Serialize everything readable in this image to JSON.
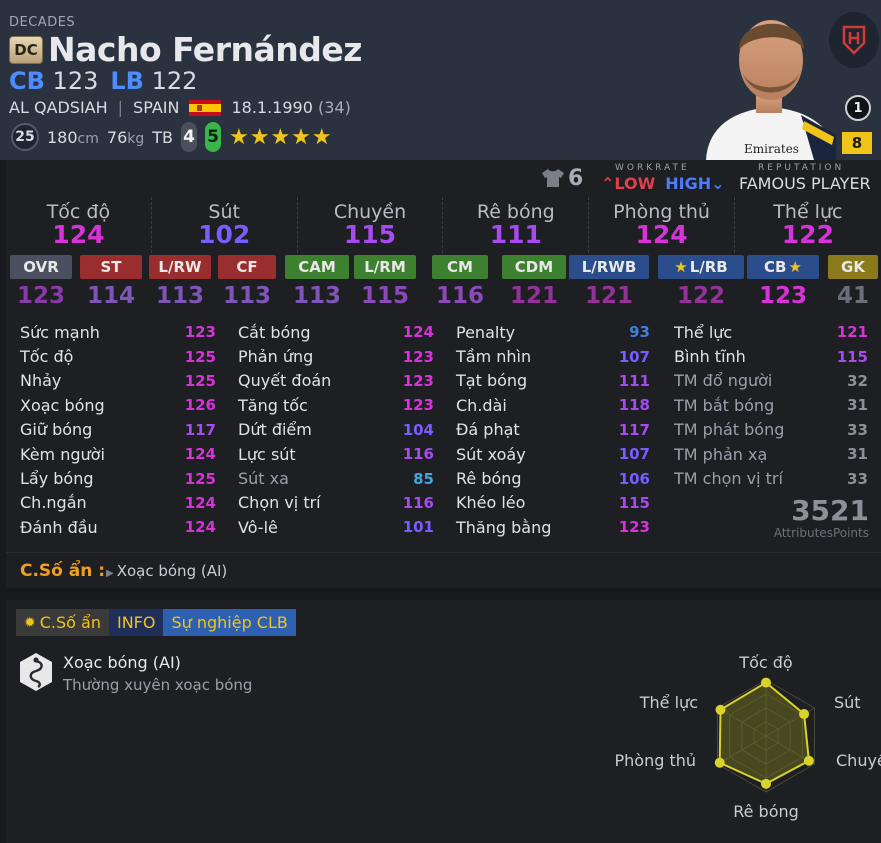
{
  "header": {
    "season": "DECADES",
    "season_badge": "DC",
    "player_name": "Nacho Fernández",
    "positions": [
      {
        "pos": "CB",
        "value": "123"
      },
      {
        "pos": "LB",
        "value": "122"
      }
    ],
    "club": "AL QADSIAH",
    "nation": "SPAIN",
    "dob": "18.1.1990",
    "age": "(34)",
    "circle_value": "25",
    "height": "180",
    "height_unit": "cm",
    "weight": "76",
    "weight_unit": "kg",
    "body_type": "TB",
    "weak_foot": "4",
    "skill_moves": "5",
    "stars": "★★★★★",
    "jersey_badge": "1",
    "grade": "8"
  },
  "workrate": {
    "shirt_number": "6",
    "title": "WORKRATE",
    "attack": "LOW",
    "defense": "HIGH",
    "reputation_title": "REPUTATION",
    "reputation": "FAMOUS PLAYER"
  },
  "main_stats": [
    {
      "label": "Tốc độ",
      "value": "124",
      "color": "#d633d9"
    },
    {
      "label": "Sút",
      "value": "102",
      "color": "#7a5cff"
    },
    {
      "label": "Chuyền",
      "value": "115",
      "color": "#a74bf0"
    },
    {
      "label": "Rê bóng",
      "value": "111",
      "color": "#a74bf0"
    },
    {
      "label": "Phòng thủ",
      "value": "124",
      "color": "#d633d9"
    },
    {
      "label": "Thể lực",
      "value": "122",
      "color": "#d633d9"
    }
  ],
  "position_ratings": [
    {
      "pos": "OVR",
      "value": "123",
      "group": "ovr",
      "color": "#8a3aa8"
    },
    {
      "pos": "ST",
      "value": "114",
      "group": "fw",
      "color": "#7e56b8"
    },
    {
      "pos": "L/RW",
      "value": "113",
      "group": "fw",
      "color": "#7e56b8"
    },
    {
      "pos": "CF",
      "value": "113",
      "group": "fw",
      "color": "#7e56b8"
    },
    {
      "pos": "CAM",
      "value": "113",
      "group": "mf",
      "color": "#7e56b8"
    },
    {
      "pos": "L/RM",
      "value": "115",
      "group": "mf",
      "color": "#8a4ab8"
    },
    {
      "pos": "CM",
      "value": "116",
      "group": "mf",
      "color": "#8a4ab8"
    },
    {
      "pos": "CDM",
      "value": "121",
      "group": "mf",
      "color": "#94329a"
    },
    {
      "pos": "L/RWB",
      "value": "121",
      "group": "df",
      "color": "#94329a"
    },
    {
      "pos": "L/RB",
      "value": "122",
      "group": "df",
      "color": "#94329a",
      "star": "★"
    },
    {
      "pos": "CB",
      "value": "123",
      "group": "df",
      "color": "#d633d9",
      "star": "★"
    },
    {
      "pos": "GK",
      "value": "41",
      "group": "gk",
      "color": "#6b6f78"
    }
  ],
  "attributes": [
    [
      {
        "name": "Sức mạnh",
        "value": "123",
        "color": "#d633d9"
      },
      {
        "name": "Tốc độ",
        "value": "125",
        "color": "#d633d9"
      },
      {
        "name": "Nhảy",
        "value": "125",
        "color": "#d633d9"
      },
      {
        "name": "Xoạc bóng",
        "value": "126",
        "color": "#d633d9"
      },
      {
        "name": "Giữ bóng",
        "value": "117",
        "color": "#a74bf0"
      },
      {
        "name": "Kèm người",
        "value": "124",
        "color": "#d633d9"
      },
      {
        "name": "Lẩy bóng",
        "value": "125",
        "color": "#d633d9"
      },
      {
        "name": "Ch.ngắn",
        "value": "124",
        "color": "#d633d9"
      },
      {
        "name": "Đánh đầu",
        "value": "124",
        "color": "#d633d9"
      }
    ],
    [
      {
        "name": "Cắt bóng",
        "value": "124",
        "color": "#d633d9"
      },
      {
        "name": "Phản ứng",
        "value": "123",
        "color": "#d633d9"
      },
      {
        "name": "Quyết đoán",
        "value": "123",
        "color": "#d633d9"
      },
      {
        "name": "Tăng tốc",
        "value": "123",
        "color": "#d633d9"
      },
      {
        "name": "Dứt điểm",
        "value": "104",
        "color": "#7a5cff"
      },
      {
        "name": "Lực sút",
        "value": "116",
        "color": "#a74bf0"
      },
      {
        "name": "Sút xa",
        "value": "85",
        "color": "#3fa8e0",
        "dim": true
      },
      {
        "name": "Chọn vị trí",
        "value": "116",
        "color": "#a74bf0"
      },
      {
        "name": "Vô-lê",
        "value": "101",
        "color": "#7a5cff"
      }
    ],
    [
      {
        "name": "Penalty",
        "value": "93",
        "color": "#3f7de0"
      },
      {
        "name": "Tầm nhìn",
        "value": "107",
        "color": "#7a5cff"
      },
      {
        "name": "Tạt bóng",
        "value": "111",
        "color": "#a74bf0"
      },
      {
        "name": "Ch.dài",
        "value": "118",
        "color": "#a74bf0"
      },
      {
        "name": "Đá phạt",
        "value": "117",
        "color": "#a74bf0"
      },
      {
        "name": "Sút xoáy",
        "value": "107",
        "color": "#7a5cff"
      },
      {
        "name": "Rê bóng",
        "value": "106",
        "color": "#7a5cff"
      },
      {
        "name": "Khéo léo",
        "value": "115",
        "color": "#a74bf0"
      },
      {
        "name": "Thăng bằng",
        "value": "123",
        "color": "#d633d9"
      }
    ],
    [
      {
        "name": "Thể lực",
        "value": "121",
        "color": "#d633d9"
      },
      {
        "name": "Bình tĩnh",
        "value": "115",
        "color": "#a74bf0"
      },
      {
        "name": "TM đổ người",
        "value": "32",
        "color": "#8c9099",
        "dim": true
      },
      {
        "name": "TM bắt bóng",
        "value": "31",
        "color": "#8c9099",
        "dim": true
      },
      {
        "name": "TM phát bóng",
        "value": "33",
        "color": "#8c9099",
        "dim": true
      },
      {
        "name": "TM phản xạ",
        "value": "31",
        "color": "#8c9099",
        "dim": true
      },
      {
        "name": "TM chọn vị trí",
        "value": "33",
        "color": "#8c9099",
        "dim": true
      }
    ]
  ],
  "points": {
    "value": "3521",
    "label": "AttributesPoints"
  },
  "hidden_traits": {
    "title": "C.Số ẩn :",
    "items": [
      "Xoạc bóng (AI)"
    ]
  },
  "tabs": {
    "hidden": "C.Số ẩn",
    "info": "INFO",
    "career": "Sự nghiệp CLB"
  },
  "trait": {
    "name": "Xoạc bóng (AI)",
    "description": "Thường xuyên xoạc bóng"
  },
  "radar": {
    "labels": [
      "Tốc độ",
      "Sút",
      "Chuyền",
      "Rê bóng",
      "Phòng thủ",
      "Thể lực"
    ],
    "values": [
      124,
      102,
      115,
      111,
      124,
      122
    ],
    "fill_color": "#6b6a1f",
    "line_color": "#d8d32a"
  }
}
